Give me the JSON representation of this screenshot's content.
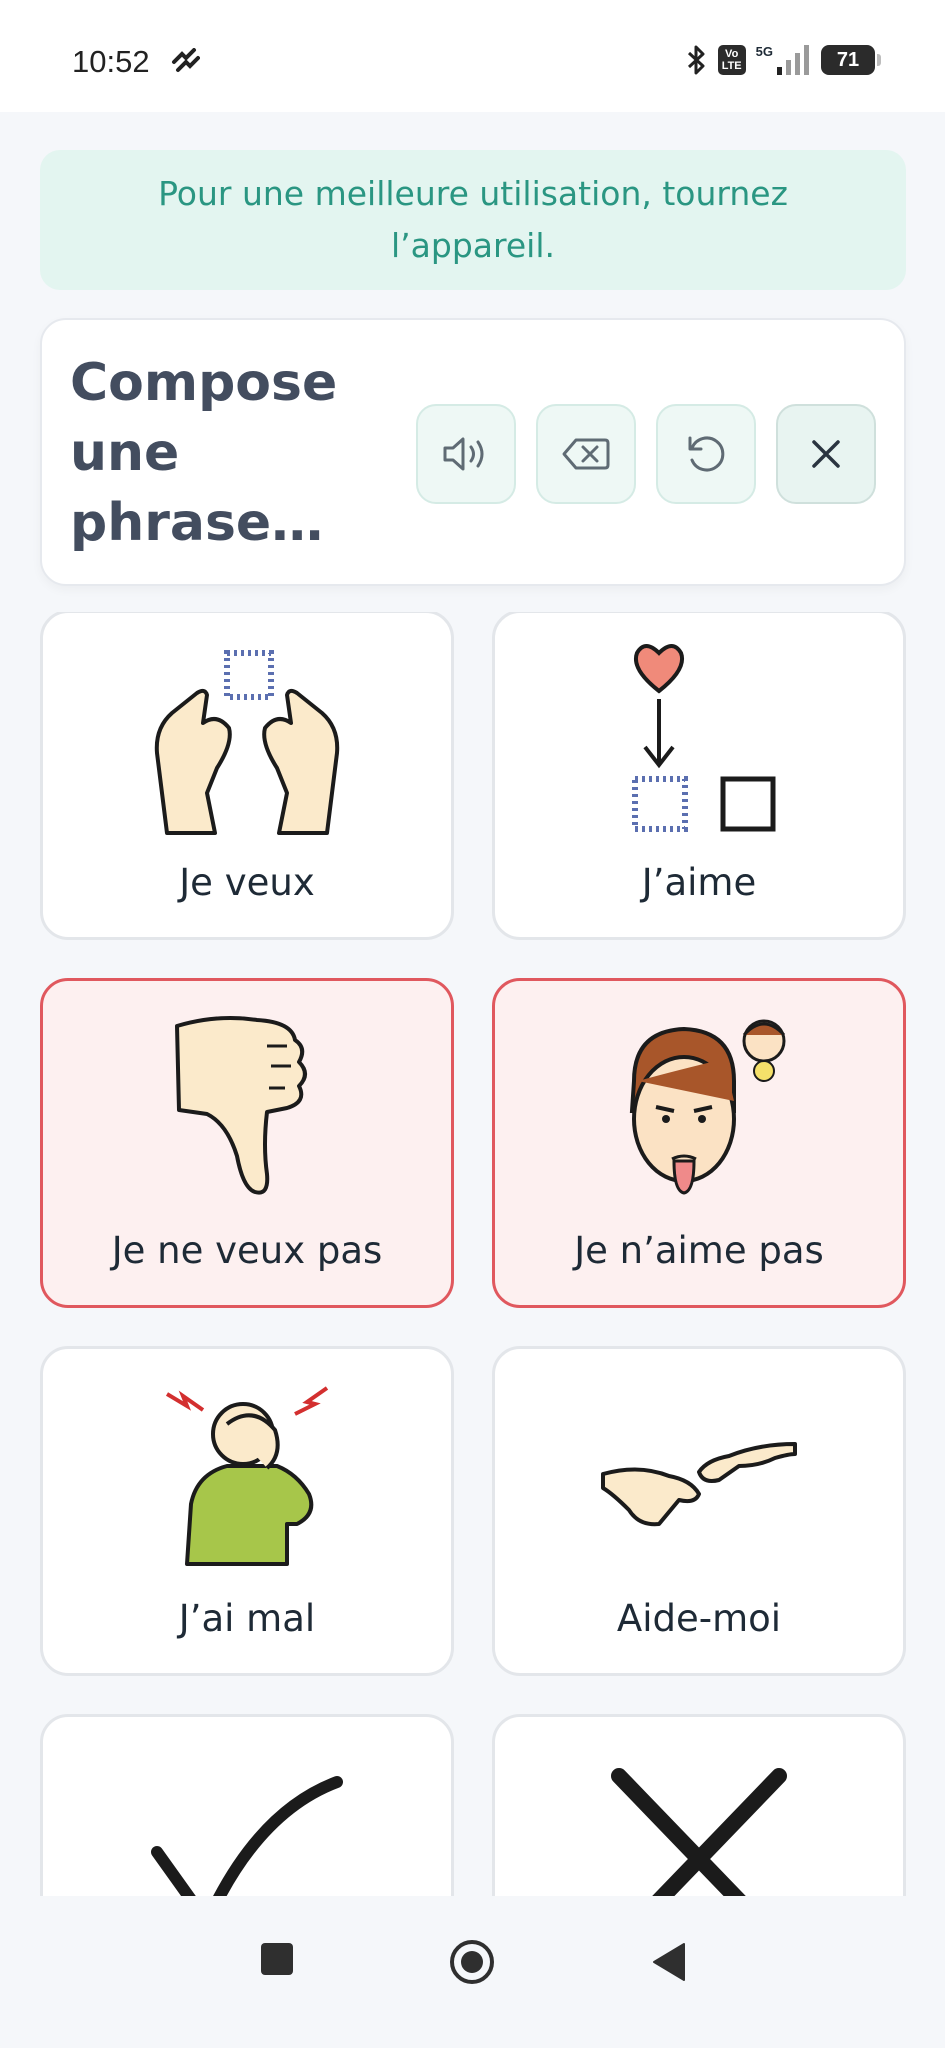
{
  "status": {
    "time": "10:52",
    "network": "5G",
    "volte_line1": "Vo",
    "volte_line2": "LTE",
    "battery": "71"
  },
  "banner": {
    "text": "Pour une meilleure utilisation, tournez l’appareil."
  },
  "composer": {
    "placeholder": "Compose une phrase…",
    "controls": [
      {
        "icon": "speaker-icon"
      },
      {
        "icon": "backspace-icon"
      },
      {
        "icon": "undo-icon"
      },
      {
        "icon": "close-icon"
      }
    ]
  },
  "cards": [
    {
      "label": "Je veux",
      "icon": "want-hands-icon",
      "negative": false
    },
    {
      "label": "J’aime",
      "icon": "like-heart-icon",
      "negative": false
    },
    {
      "label": "Je ne veux pas",
      "icon": "thumbs-down-icon",
      "negative": true
    },
    {
      "label": "Je n’aime pas",
      "icon": "disgust-face-icon",
      "negative": true
    },
    {
      "label": "J’ai mal",
      "icon": "headache-person-icon",
      "negative": false
    },
    {
      "label": "Aide-moi",
      "icon": "helping-hands-icon",
      "negative": false
    },
    {
      "label": "",
      "icon": "checkmark-icon",
      "negative": false
    },
    {
      "label": "",
      "icon": "cross-icon",
      "negative": false
    }
  ],
  "colors": {
    "accent": "#2a9682",
    "negative_border": "#e0585e",
    "negative_bg": "#fdf0f0",
    "banner_bg": "#e3f5f0"
  }
}
